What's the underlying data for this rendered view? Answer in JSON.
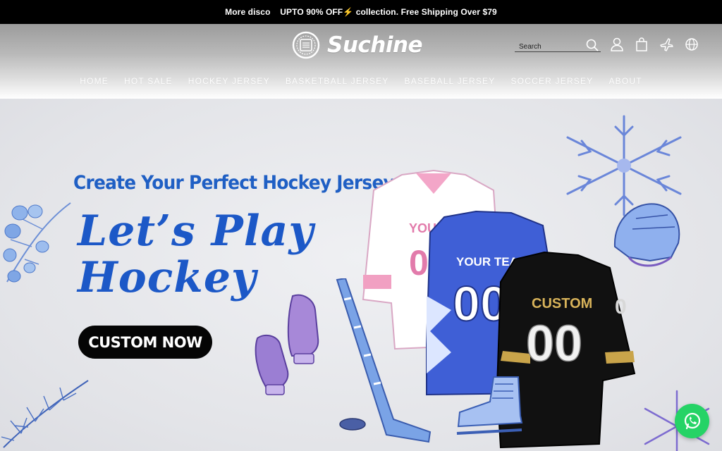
{
  "announcement": {
    "text": "More disco    UPTO 90% OFF⚡ collection. Free Shipping Over $79"
  },
  "header": {
    "brand": "Suchine",
    "search": {
      "placeholder": "Search"
    },
    "icons": [
      "search-icon",
      "user-icon",
      "bag-icon",
      "plane-icon",
      "globe-icon"
    ]
  },
  "nav": {
    "items": [
      {
        "label": "HOME"
      },
      {
        "label": "HOT SALE"
      },
      {
        "label": "HOCKEY JERSEY"
      },
      {
        "label": "BASKETBALL JERSEY"
      },
      {
        "label": "BASEBALL JERSEY"
      },
      {
        "label": "SOCCER JERSEY"
      },
      {
        "label": "ABOUT"
      }
    ]
  },
  "hero": {
    "subtitle": "Create Your Perfect Hockey Jersey",
    "title_line1": "Let’s Play",
    "title_line2": "Hockey",
    "cta": "CUSTOM NOW",
    "jerseys": [
      {
        "name": "pink-white",
        "team": "YOUR TEAM",
        "number": "00"
      },
      {
        "name": "blue",
        "team": "YOUR TEAM",
        "number": "00"
      },
      {
        "name": "black-gold",
        "team": "CUSTOM",
        "number": "00"
      }
    ]
  },
  "colors": {
    "accent": "#1c58c7",
    "announcement_bg": "#000000",
    "cta_bg": "#050505",
    "whatsapp": "#25d366"
  }
}
